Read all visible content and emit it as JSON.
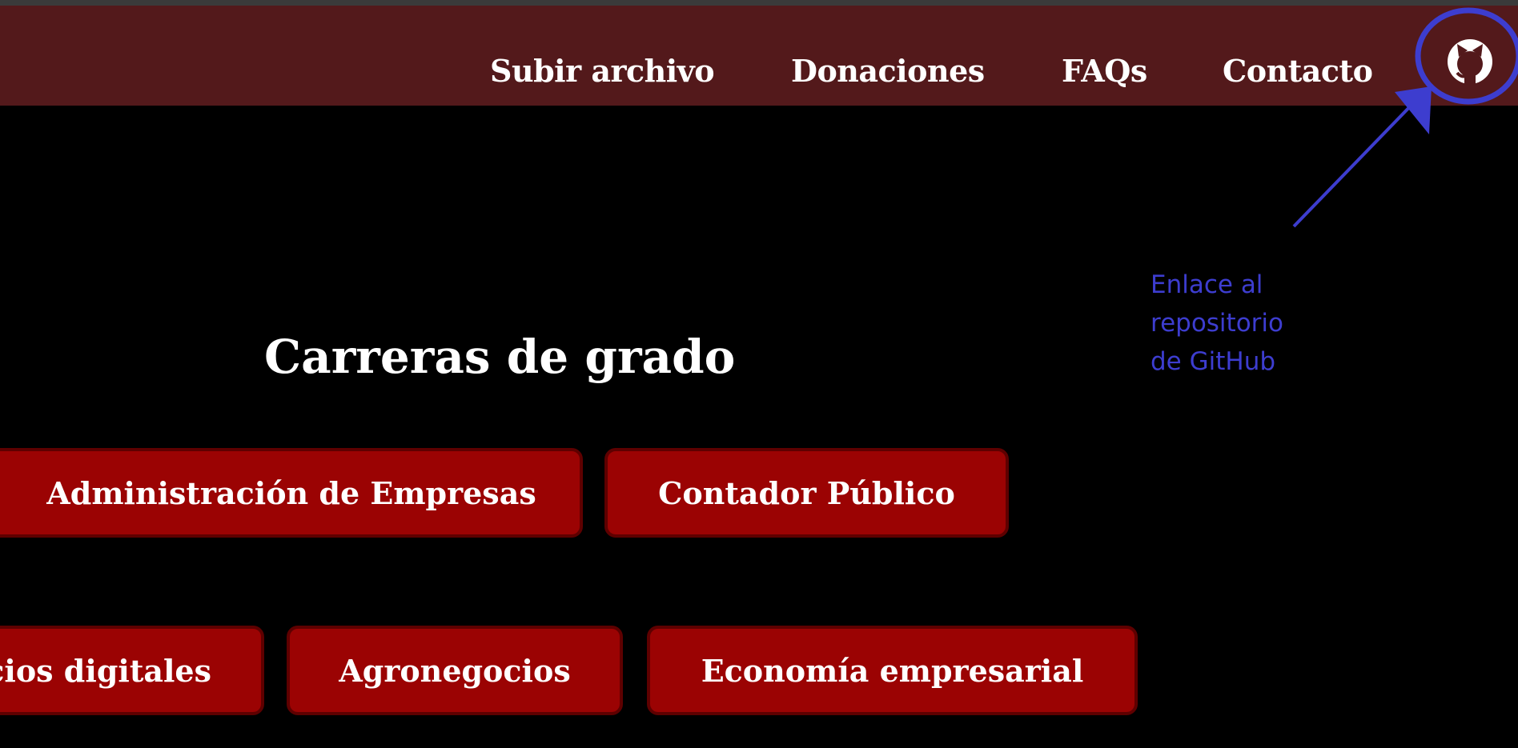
{
  "nav": {
    "links": [
      {
        "label": "Subir archivo"
      },
      {
        "label": "Donaciones"
      },
      {
        "label": "FAQs"
      },
      {
        "label": "Contacto"
      }
    ],
    "github_icon": "github-icon"
  },
  "main": {
    "title": "Carreras de grado",
    "careers": [
      {
        "label": "Administración de Empresas"
      },
      {
        "label": "Contador Público"
      },
      {
        "label": "cios digitales"
      },
      {
        "label": "Agronegocios"
      },
      {
        "label": "Economía empresarial"
      }
    ]
  },
  "annotation": {
    "lines": [
      "Enlace al",
      "repositorio",
      "de GitHub"
    ],
    "color": "#3d3dcf"
  },
  "colors": {
    "navbar": "#53191b",
    "button": "#9b0303",
    "button_border": "#5e0000",
    "background": "#000000"
  }
}
